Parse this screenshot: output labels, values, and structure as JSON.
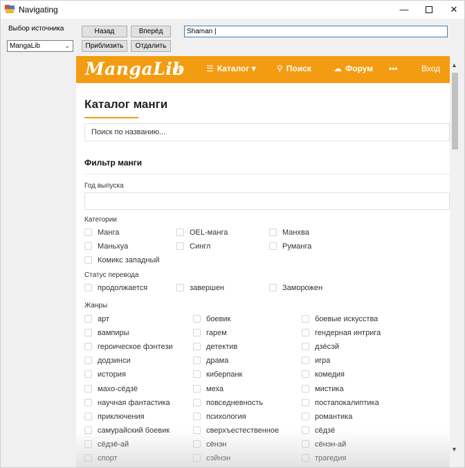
{
  "window": {
    "title": "Navigating",
    "minimize_glyph": "—",
    "close_glyph": "✕"
  },
  "controls": {
    "source_label": "Выбор источника",
    "source_value": "MangaLib",
    "back": "Назад",
    "forward": "Вперёд",
    "zoom_in": "Приблизить",
    "zoom_out": "Отдалить",
    "url_value": "Shaman |"
  },
  "site": {
    "logo": "MangaLib",
    "nav_catalog": "Каталог",
    "nav_catalog_caret": "▾",
    "nav_search": "Поиск",
    "nav_forum": "Форум",
    "nav_more": "•••",
    "nav_login": "Вход",
    "accent_color": "#f39c12"
  },
  "page": {
    "title": "Каталог манги",
    "search_placeholder": "Поиск по названию...",
    "filter_title": "Фильтр манги",
    "year_label": "Год выпуска",
    "categories_label": "Категории",
    "status_label": "Статус перевода",
    "genres_label": "Жанры"
  },
  "categories": [
    "Манга",
    "OEL-манга",
    "Манхва",
    "Маньхуа",
    "Сингл",
    "Руманга",
    "Комикс западный"
  ],
  "statuses": [
    "продолжается",
    "завершен",
    "Заморожен"
  ],
  "genres": [
    "арт",
    "боевик",
    "боевые искусства",
    "вампиры",
    "гарем",
    "гендерная интрига",
    "героическое фэнтези",
    "детектив",
    "дзёсэй",
    "додзинси",
    "драма",
    "игра",
    "история",
    "киберпанк",
    "комедия",
    "махо-сёдзё",
    "меха",
    "мистика",
    "научная фантастика",
    "повседневность",
    "постапокалиптика",
    "приключения",
    "психология",
    "романтика",
    "самурайский боевик",
    "сверхъестественное",
    "сёдзё",
    "сёдзё-ай",
    "сёнэн",
    "сёнэн-ай",
    "спорт",
    "сэйнэн",
    "трагедия"
  ]
}
